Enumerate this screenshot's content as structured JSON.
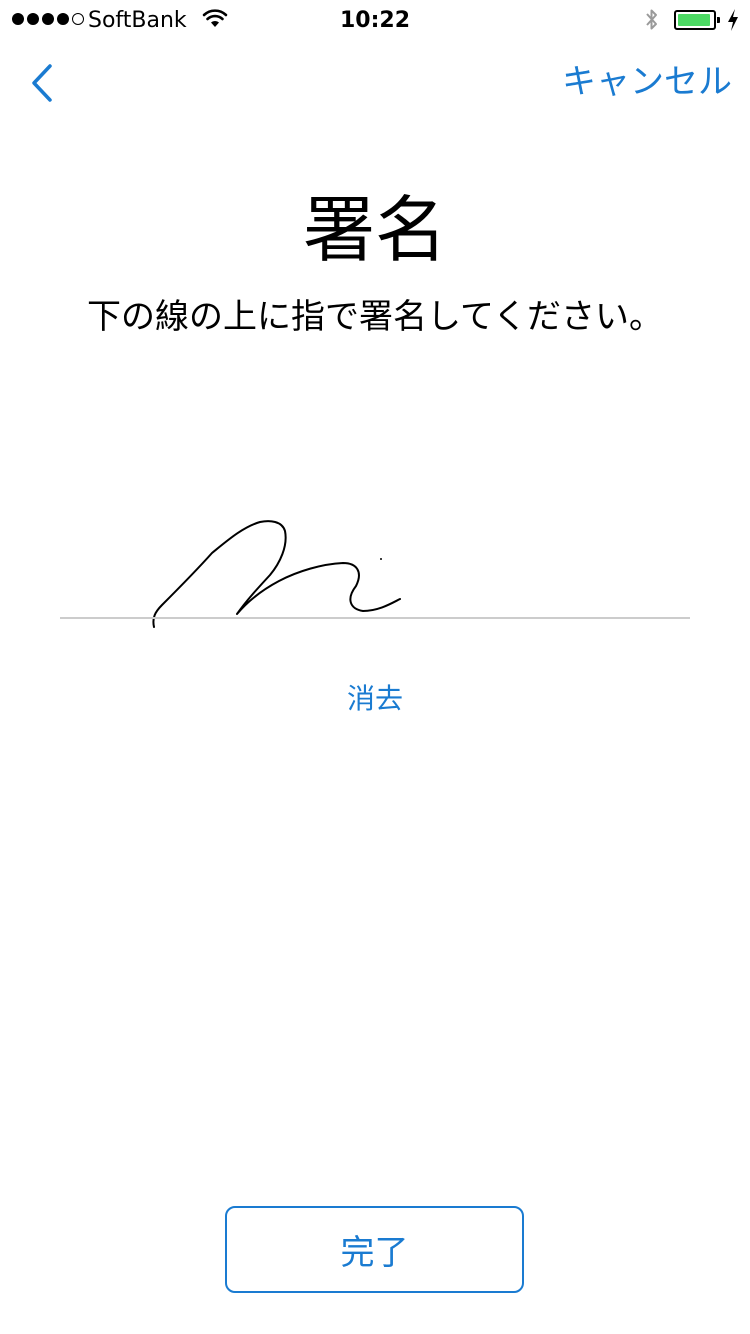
{
  "status_bar": {
    "carrier": "SoftBank",
    "time": "10:22",
    "signal_bars_filled": 4,
    "signal_bars_total": 5,
    "battery_level": 0.8,
    "battery_color": "#4cd964"
  },
  "nav": {
    "back_icon": "chevron-left-icon",
    "cancel_label": "キャンセル"
  },
  "main": {
    "title": "署名",
    "instruction": "下の線の上に指で署名してください。",
    "clear_label": "消去",
    "done_label": "完了"
  },
  "colors": {
    "accent": "#1a7bd1",
    "divider": "#cccccc"
  }
}
